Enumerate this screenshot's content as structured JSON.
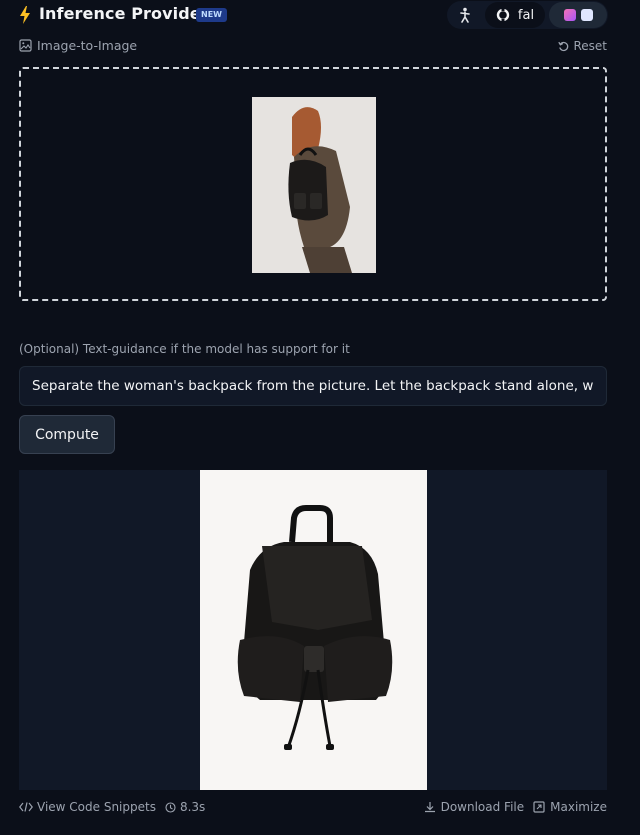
{
  "header": {
    "title": "Inference Providers",
    "badge": "NEW",
    "providers": [
      {
        "name": "dancer-icon",
        "label": ""
      },
      {
        "name": "fal",
        "label": "fal"
      },
      {
        "name": "multi-provider",
        "label": ""
      }
    ]
  },
  "task": {
    "label": "Image-to-Image",
    "reset_label": "Reset"
  },
  "input": {
    "guidance_label": "(Optional) Text-guidance if the model has support for it",
    "prompt_value": "Separate the woman's backpack from the picture. Let the backpack stand alone, with",
    "compute_label": "Compute"
  },
  "footer": {
    "snippets_label": "View Code Snippets",
    "time_label": "8.3s",
    "download_label": "Download File",
    "maximize_label": "Maximize"
  },
  "colors": {
    "background": "#0b0f19",
    "accent_bolt": "#fbbf24",
    "badge_bg": "#1e3a8a"
  }
}
